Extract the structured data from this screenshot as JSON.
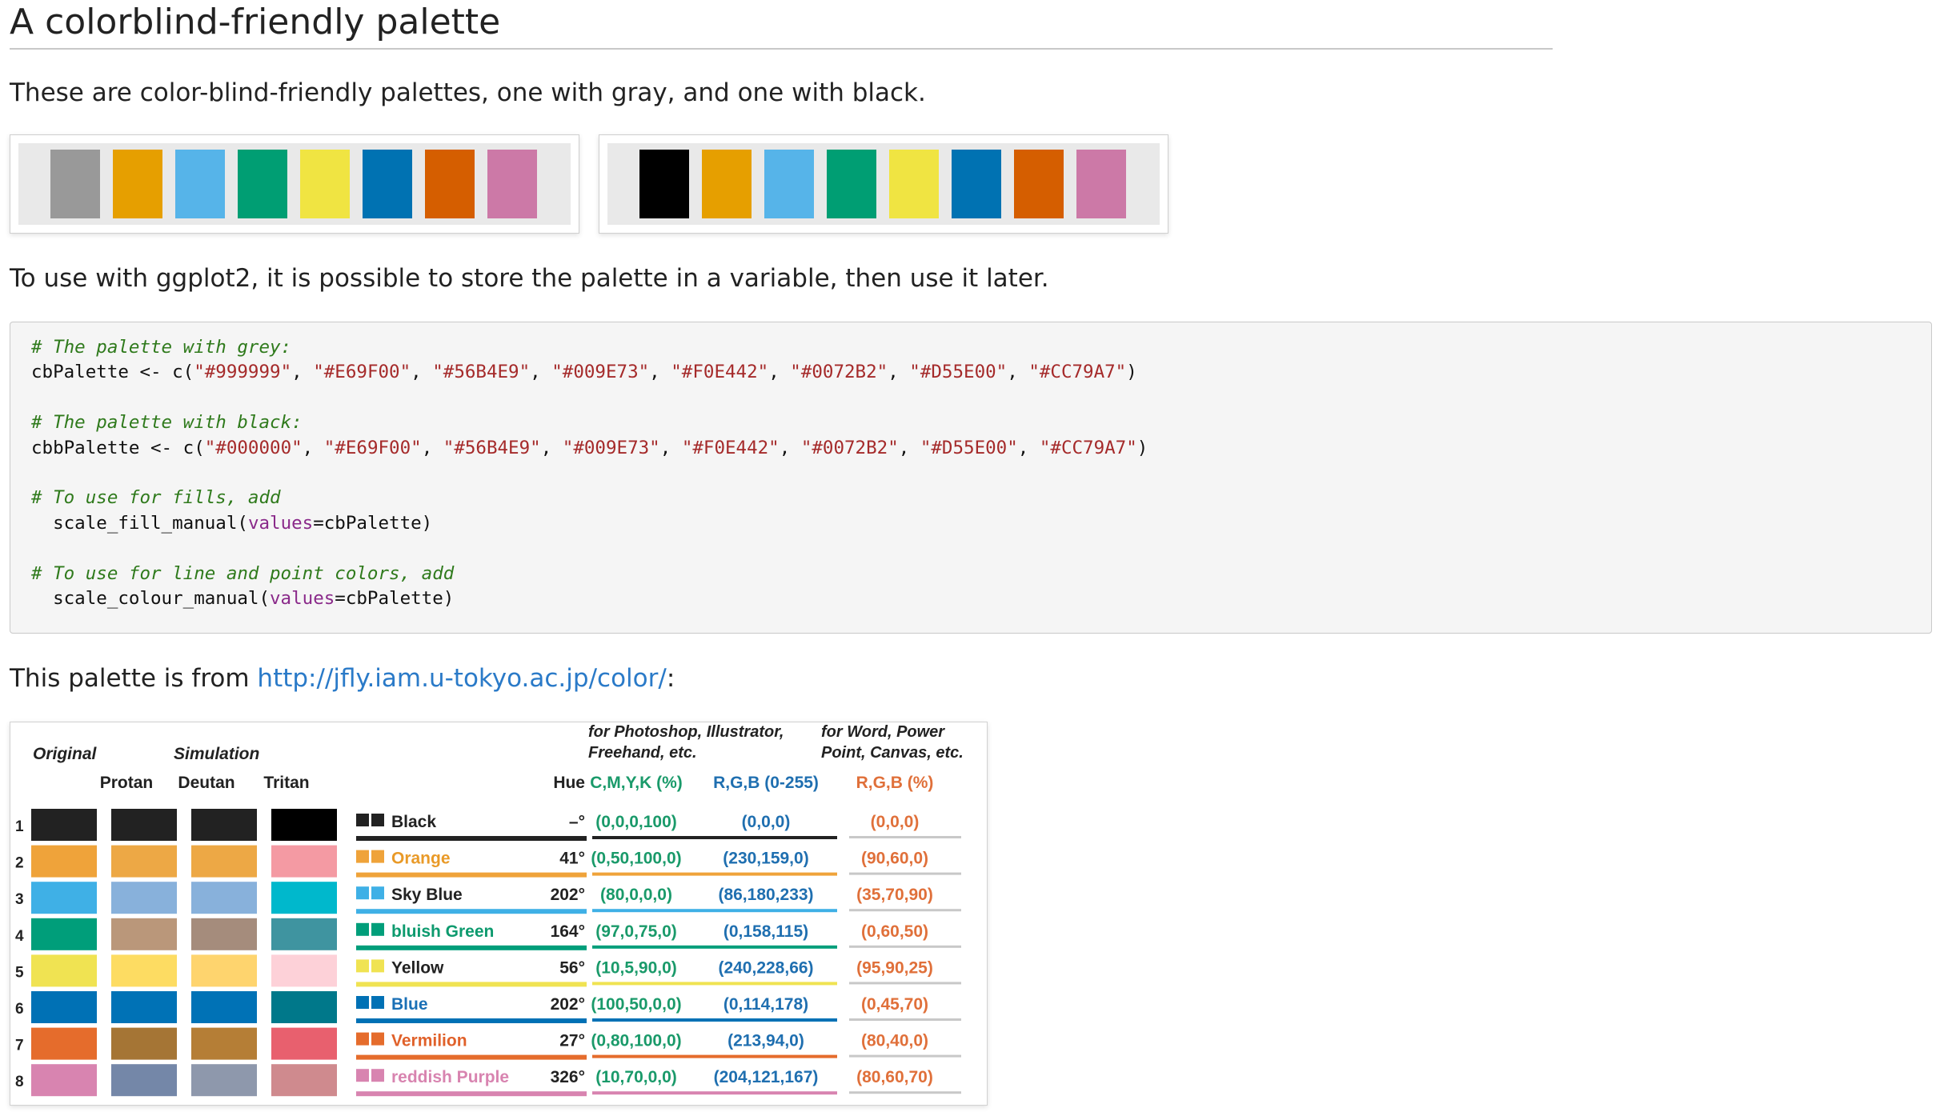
{
  "title": "A colorblind-friendly palette",
  "intro": "These are color-blind-friendly palettes, one with gray, and one with black.",
  "palettes": {
    "grey": [
      "#999999",
      "#E69F00",
      "#56B4E9",
      "#009E73",
      "#F0E442",
      "#0072B2",
      "#D55E00",
      "#CC79A7"
    ],
    "black": [
      "#000000",
      "#E69F00",
      "#56B4E9",
      "#009E73",
      "#F0E442",
      "#0072B2",
      "#D55E00",
      "#CC79A7"
    ]
  },
  "usage_text": "To use with ggplot2, it is possible to store the palette in a variable, then use it later.",
  "code": {
    "comment_grey": "# The palette with grey:",
    "var_grey": "cbPalette",
    "comment_black": "# The palette with black:",
    "var_black": "cbbPalette",
    "comment_fill": "# To use for fills, add",
    "fill_fn": "scale_fill_manual",
    "comment_colour": "# To use for line and point colors, add",
    "colour_fn": "scale_colour_manual",
    "arg_name": "values",
    "arg_value": "cbPalette"
  },
  "source": {
    "prefix": "This palette is from ",
    "link": "http://jfly.iam.u-tokyo.ac.jp/color/",
    "suffix": ":"
  },
  "figure": {
    "headers": {
      "original": "Original",
      "simulation": "Simulation",
      "protan": "Protan",
      "deutan": "Deutan",
      "tritan": "Tritan",
      "hue": "Hue",
      "group1_line1": "for Photoshop, Illustrator,",
      "group1_line2": "Freehand, etc.",
      "group2_line1": "for Word, Power",
      "group2_line2": "Point, Canvas, etc.",
      "cmyk": "C,M,Y,K (%)",
      "rgb255": "R,G,B (0-255)",
      "rgbpct": "R,G,B (%)"
    },
    "colors": {
      "cmyk_header": "#1a9a6a",
      "rgb255_header": "#1f6fb0",
      "rgbpct_header": "#e0703a"
    },
    "rows": [
      {
        "n": "1",
        "name": "Black",
        "hue": "–°",
        "cmyk": "(0,0,0,100)",
        "rgb": "(0,0,0)",
        "pct": "(0,0,0)",
        "orig": "#222222",
        "protan": "#222222",
        "deutan": "#222222",
        "tritan": "#000000",
        "text": "#222222"
      },
      {
        "n": "2",
        "name": "Orange",
        "hue": "41°",
        "cmyk": "(0,50,100,0)",
        "rgb": "(230,159,0)",
        "pct": "(90,60,0)",
        "orig": "#EFA33A",
        "protan": "#EDA845",
        "deutan": "#EDA845",
        "tritan": "#F49AA3",
        "text": "#E99A28"
      },
      {
        "n": "3",
        "name": "Sky Blue",
        "hue": "202°",
        "cmyk": "(80,0,0,0)",
        "rgb": "(86,180,233)",
        "pct": "(35,70,90)",
        "orig": "#3FB0E6",
        "protan": "#88B1DB",
        "deutan": "#88B1DB",
        "tritan": "#00B8CC",
        "text": "#222222"
      },
      {
        "n": "4",
        "name": "bluish Green",
        "hue": "164°",
        "cmyk": "(97,0,75,0)",
        "rgb": "(0,158,115)",
        "pct": "(0,60,50)",
        "orig": "#009E7A",
        "protan": "#BA977A",
        "deutan": "#A58C7C",
        "tritan": "#3F94A0",
        "text": "#0D9A6E"
      },
      {
        "n": "5",
        "name": "Yellow",
        "hue": "56°",
        "cmyk": "(10,5,90,0)",
        "rgb": "(240,228,66)",
        "pct": "(95,90,25)",
        "orig": "#F0E352",
        "protan": "#FDDC62",
        "deutan": "#FED46E",
        "tritan": "#FDD1D8",
        "text": "#222222"
      },
      {
        "n": "6",
        "name": "Blue",
        "hue": "202°",
        "cmyk": "(100,50,0,0)",
        "rgb": "(0,114,178)",
        "pct": "(0,45,70)",
        "orig": "#0071B5",
        "protan": "#0072B6",
        "deutan": "#0072B6",
        "tritan": "#00788A",
        "text": "#1a70b6"
      },
      {
        "n": "7",
        "name": "Vermilion",
        "hue": "27°",
        "cmyk": "(0,80,100,0)",
        "rgb": "(213,94,0)",
        "pct": "(80,40,0)",
        "orig": "#E56C2C",
        "protan": "#A57535",
        "deutan": "#B57E36",
        "tritan": "#E8606E",
        "text": "#E0612A"
      },
      {
        "n": "8",
        "name": "reddish Purple",
        "hue": "326°",
        "cmyk": "(10,70,0,0)",
        "rgb": "(204,121,167)",
        "pct": "(80,60,70)",
        "orig": "#D884B0",
        "protan": "#7487A8",
        "deutan": "#8E98AC",
        "tritan": "#CF8A8E",
        "text": "#D884B0"
      }
    ]
  }
}
